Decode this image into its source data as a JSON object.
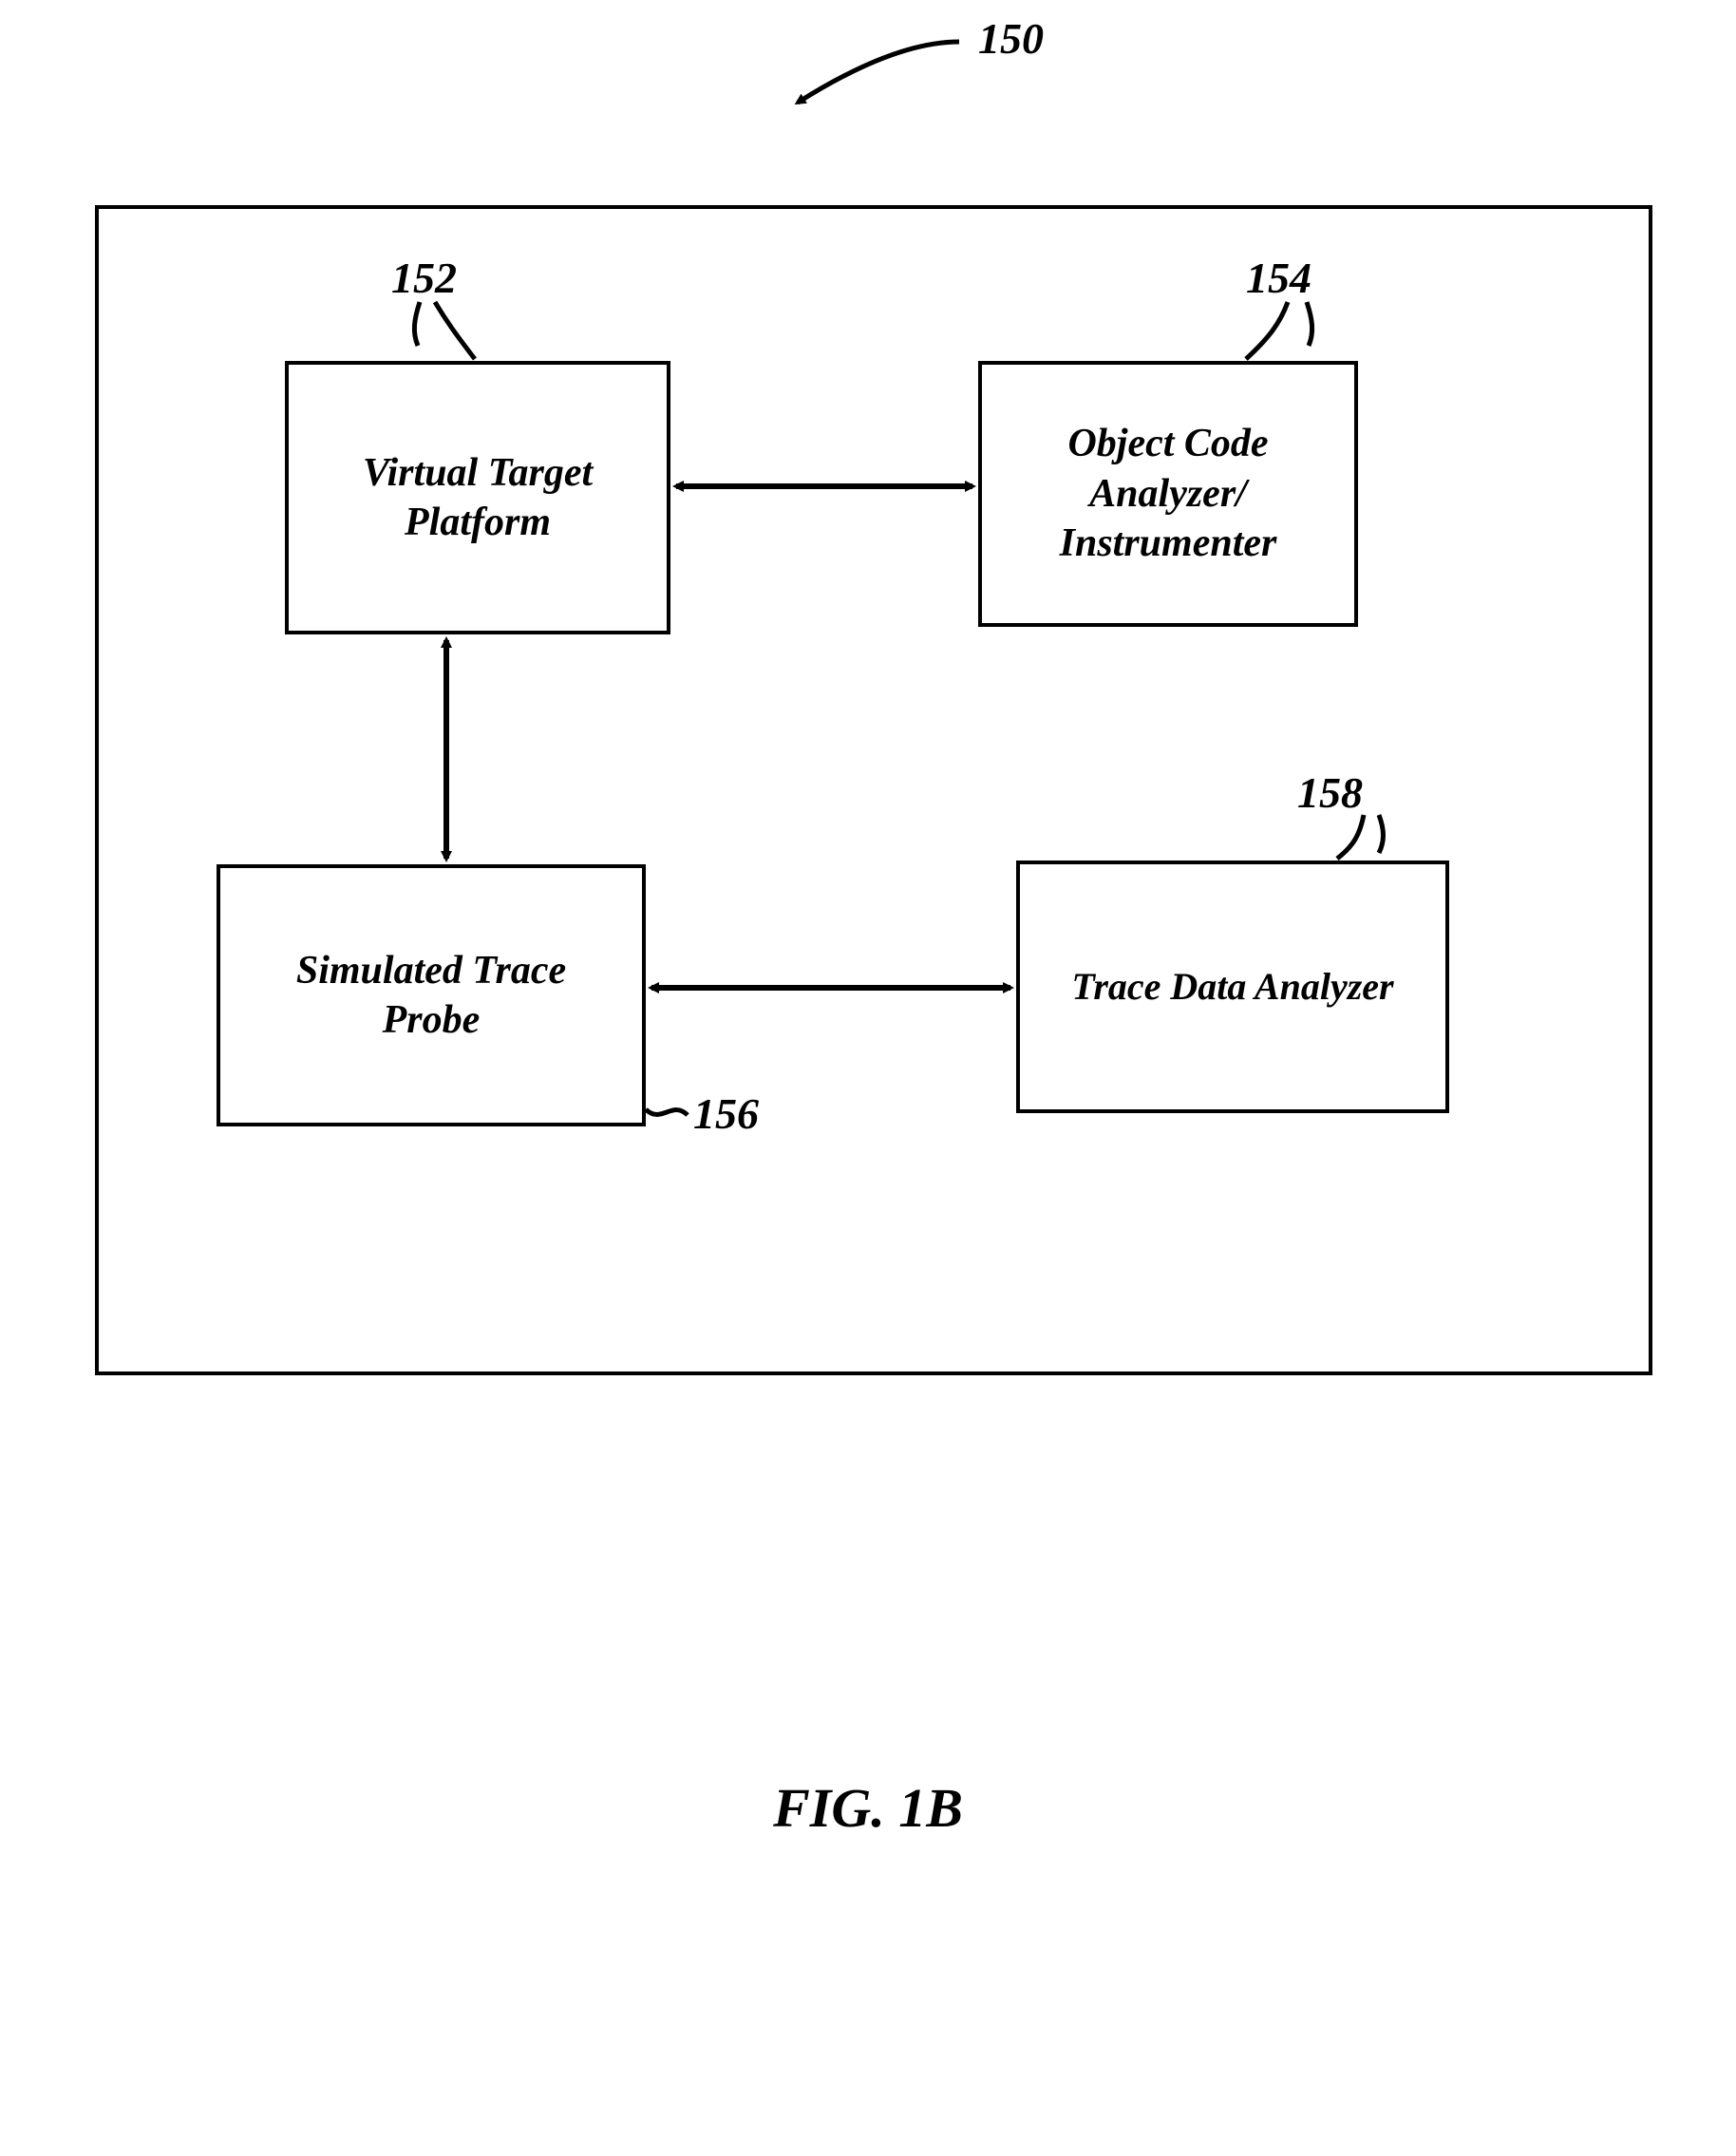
{
  "figure": {
    "ref": "150",
    "caption": "FIG. 1B"
  },
  "blocks": {
    "virtual_target_platform": {
      "label": "Virtual Target\nPlatform",
      "ref": "152"
    },
    "object_code_analyzer": {
      "label": "Object Code\nAnalyzer/\nInstrumenter",
      "ref": "154"
    },
    "simulated_trace_probe": {
      "label": "Simulated Trace\nProbe",
      "ref": "156"
    },
    "trace_data_analyzer": {
      "label": "Trace Data Analyzer",
      "ref": "158"
    }
  }
}
